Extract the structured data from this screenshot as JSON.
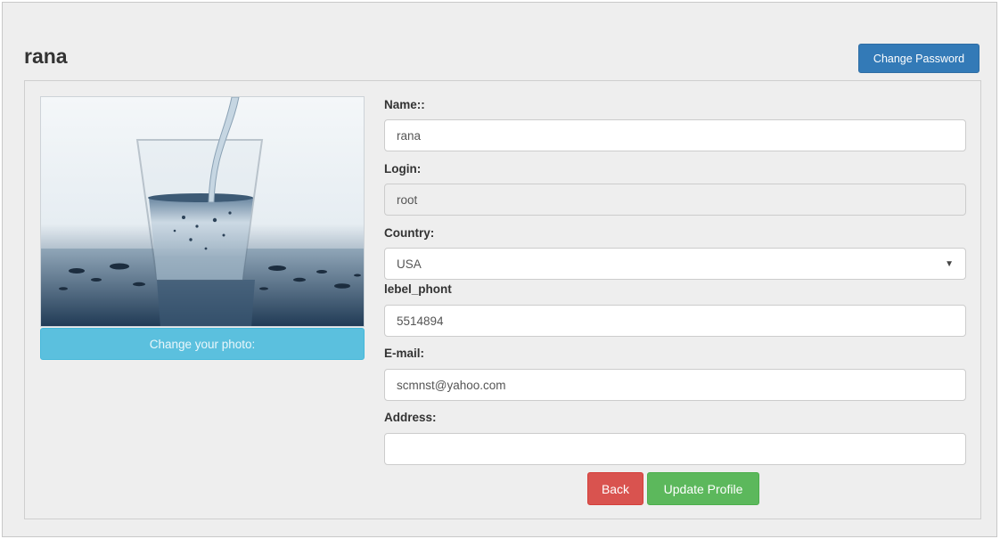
{
  "profile": {
    "username": "rana",
    "change_password_label": "Change Password",
    "photo_caption": "Change your photo:"
  },
  "form": {
    "name": {
      "label": "Name::",
      "value": "rana"
    },
    "login": {
      "label": "Login:",
      "value": "root"
    },
    "country": {
      "label": "Country:",
      "value": "USA"
    },
    "phone": {
      "label": "lebel_phont",
      "value": "5514894"
    },
    "email": {
      "label": "E-mail:",
      "value": "scmnst@yahoo.com"
    },
    "address": {
      "label": "Address:",
      "value": ""
    }
  },
  "actions": {
    "back_label": "Back",
    "update_label": "Update Profile"
  },
  "colors": {
    "primary": "#337ab7",
    "info": "#5bc0de",
    "danger": "#d9534f",
    "success": "#5cb85c"
  },
  "icons": {
    "select_arrow": "chevron-down-icon"
  }
}
